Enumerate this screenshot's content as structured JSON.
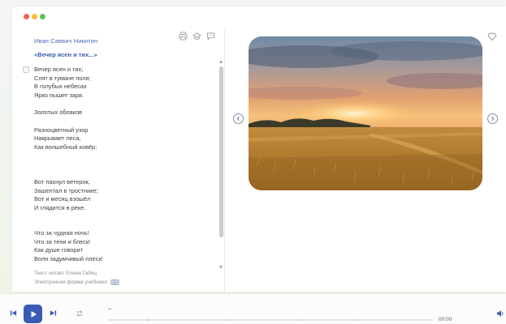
{
  "window": {
    "controls": [
      "close",
      "minimize",
      "maximize"
    ]
  },
  "text_panel": {
    "author": "Иван Саввич Никитин",
    "poem_title": "«Вечер ясен и тих...»",
    "tools": [
      "print-icon",
      "graduation-cap-icon",
      "comment-icon"
    ],
    "stanzas": [
      [
        "Вечер ясен и тих;",
        "Спят в тумане поля;",
        "В голубых небесах",
        "Ярко пышет заря."
      ],
      [
        "Золотых облаков"
      ],
      [
        "Разноцветный узор",
        "Накрывает леса,",
        "Как волшебный ковёр;"
      ],
      [
        "Вот пахнул ветерок,",
        "Зашептал в тростнике;",
        "Вот и месяц взошёл",
        "И глядится в реке."
      ],
      [
        "Что за чудная ночь!",
        "Что за тени и блеск!",
        "Как душе говорит",
        "Волн задумчивый плеск!"
      ]
    ],
    "reader_note": "Текст читает Елена Габец"
  },
  "media_panel": {
    "image": "wheat-field-sunset-photo",
    "prev_icon": "chevron-left-icon",
    "next_icon": "chevron-right-icon",
    "favorite_icon": "heart-icon"
  },
  "footer": {
    "ebook_link": "Электронная форма учебника",
    "ebook_icon": "book-icon"
  },
  "player": {
    "time": "00:00",
    "progress": 0,
    "accent_color": "#3b5bb3"
  }
}
